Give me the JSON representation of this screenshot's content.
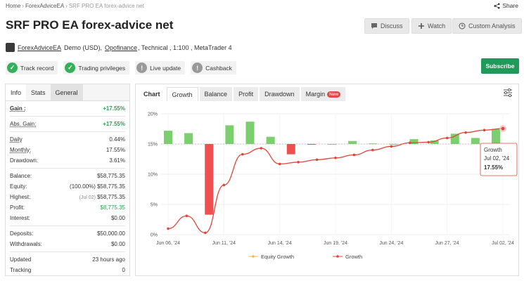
{
  "breadcrumb": {
    "home": "Home",
    "parent": "ForexAdviceEA",
    "current": "SRF PRO EA forex-advice net"
  },
  "share_label": "Share",
  "title": "SRF PRO EA forex-advice net",
  "header_buttons": {
    "discuss": "Discuss",
    "watch": "Watch",
    "custom_analysis": "Custom Analysis"
  },
  "meta": {
    "owner": "ForexAdviceEA",
    "account_type": "Demo (USD),",
    "broker": "Opofinance",
    "rest": ", Technical , 1:100 , MetaTrader 4"
  },
  "badges": {
    "track_record": "Track record",
    "trading_privileges": "Trading privileges",
    "live_update": "Live update",
    "cashback": "Cashback"
  },
  "subscribe_label": "Subscribe",
  "left_tabs": {
    "info": "Info",
    "stats": "Stats",
    "general": "General"
  },
  "stats": {
    "gain": {
      "label": "Gain :",
      "value": "+17.55%"
    },
    "abs_gain": {
      "label": "Abs. Gain:",
      "value": "+17.55%"
    },
    "daily": {
      "label": "Daily",
      "value": "0.44%"
    },
    "monthly": {
      "label": "Monthly:",
      "value": "17.55%"
    },
    "drawdown": {
      "label": "Drawdown:",
      "value": "3.61%"
    },
    "balance": {
      "label": "Balance:",
      "value": "$58,775.35"
    },
    "equity": {
      "label": "Equity:",
      "note": "(100.00%)",
      "value": "$58,775.35"
    },
    "highest": {
      "label": "Highest:",
      "note": "(Jul 02)",
      "value": "$58,775.35"
    },
    "profit": {
      "label": "Profit:",
      "value": "$8,775.35"
    },
    "interest": {
      "label": "Interest:",
      "value": "$0.00"
    },
    "deposits": {
      "label": "Deposits:",
      "value": "$50,000.00"
    },
    "withdrawals": {
      "label": "Withdrawals:",
      "value": "$0.00"
    },
    "updated": {
      "label": "Updated",
      "value": "23 hours ago"
    },
    "tracking": {
      "label": "Tracking",
      "value": "0"
    }
  },
  "chart_tabs": {
    "chart": "Chart",
    "growth": "Growth",
    "balance": "Balance",
    "profit": "Profit",
    "drawdown": "Drawdown",
    "margin": "Margin",
    "new_badge": "New"
  },
  "colors": {
    "bar_up": "#7ccf6e",
    "bar_down": "#f04f4f",
    "line": "#e0453a",
    "equity_line": "#f5b74a",
    "accent_green": "#1f9a5a"
  },
  "tooltip": {
    "series": "Growth",
    "date": "Jul 02, '24",
    "value": "17.55%"
  },
  "chart_data": {
    "type": "bar+line",
    "x_tick_labels": [
      "Jun 06, '24",
      "Jun 11, '24",
      "Jun 14, '24",
      "Jun 19, '24",
      "Jun 24, '24",
      "Jun 27, '24",
      "Jul 02, '24"
    ],
    "y_tick_labels": [
      "0%",
      "5%",
      "10%",
      "15%",
      "20%"
    ],
    "ylim": [
      0,
      20
    ],
    "baseline": 15,
    "bar_values": [
      17.2,
      16.8,
      3.3,
      18.1,
      18.7,
      16.2,
      13.3,
      14.9,
      15.0,
      15.5,
      15.1,
      15.0,
      15.8,
      15.6,
      16.7,
      16.0,
      17.5
    ],
    "series": [
      {
        "name": "Growth",
        "values": [
          1.0,
          3.1,
          0.3,
          8.2,
          13.3,
          14.3,
          11.7,
          12.0,
          12.4,
          12.7,
          13.2,
          14.0,
          14.6,
          15.2,
          15.3,
          16.0,
          16.9,
          17.3,
          17.55
        ]
      },
      {
        "name": "Equity Growth",
        "values": []
      }
    ],
    "legend": [
      "Equity Growth",
      "Growth"
    ],
    "legend_position": "bottom"
  }
}
